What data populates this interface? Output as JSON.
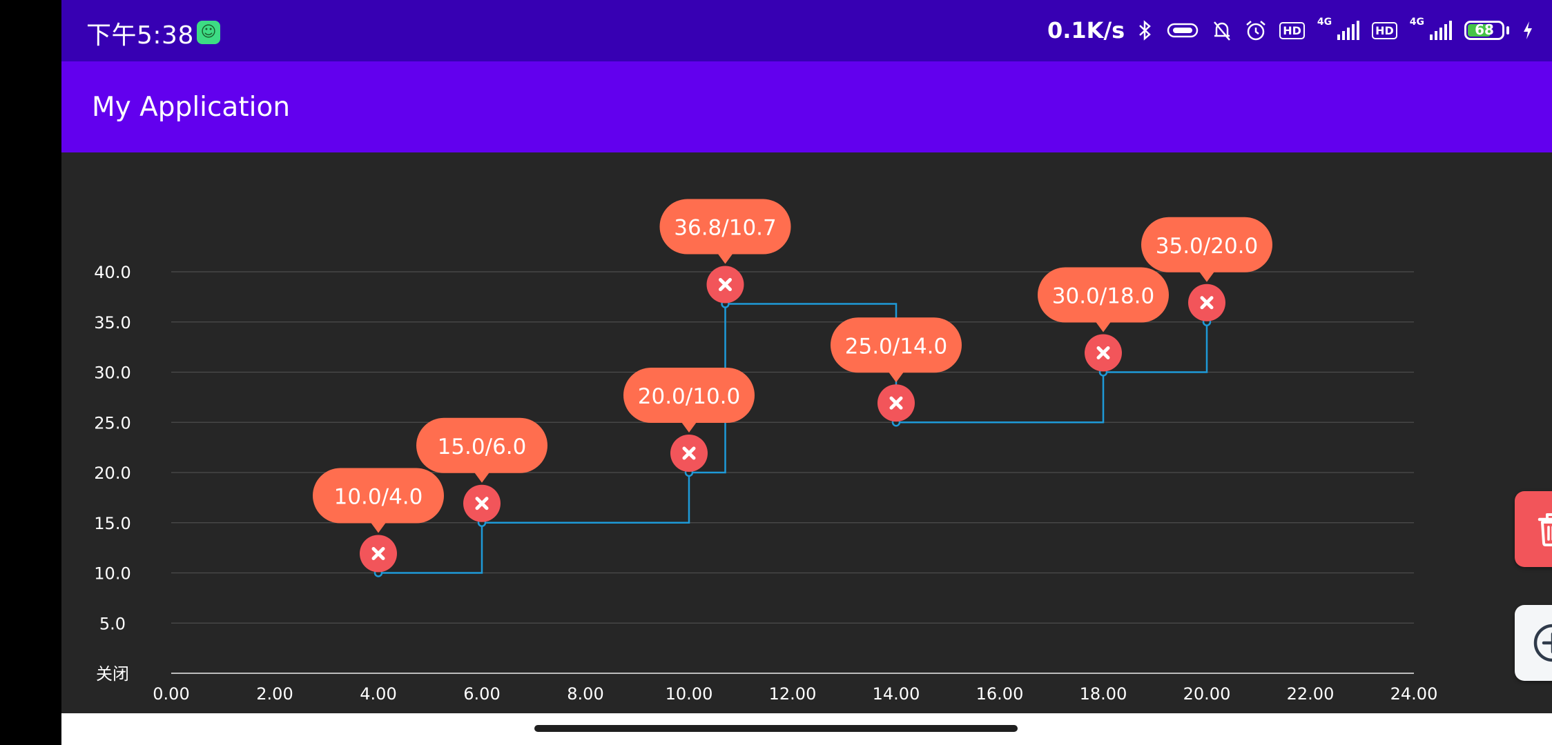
{
  "status_bar": {
    "time": "下午5:38",
    "network_speed": "0.1K/s",
    "net_type": "4G",
    "hd_label": "HD",
    "battery_level": "68",
    "icons": [
      "android-app-icon",
      "bluetooth-icon",
      "vibrate-icon",
      "mute-bell-icon",
      "alarm-icon",
      "hd-icon",
      "signal-icon",
      "battery-icon",
      "charging-icon"
    ]
  },
  "app_bar": {
    "title": "My Application"
  },
  "fabs": {
    "delete": {
      "icon": "trash-icon",
      "color": "#F2555A"
    },
    "add": {
      "icon": "add-circle-icon",
      "color": "#F4F6F8"
    }
  },
  "colors": {
    "status_bar": "#3700B3",
    "app_bar": "#6200EE",
    "chart_bg": "#262626",
    "line": "#1E9AD8",
    "bubble": "#FF6E4F",
    "marker": "#F2555A"
  },
  "chart_data": {
    "type": "line",
    "line_style": "stepped",
    "x": [
      4.0,
      6.0,
      10.0,
      10.7,
      14.0,
      18.0,
      20.0
    ],
    "y": [
      10.0,
      15.0,
      20.0,
      36.8,
      25.0,
      30.0,
      35.0
    ],
    "point_labels": [
      "10.0/4.0",
      "15.0/6.0",
      "20.0/10.0",
      "36.8/10.7",
      "25.0/14.0",
      "30.0/18.0",
      "35.0/20.0"
    ],
    "xlim": [
      0,
      24
    ],
    "ylim": [
      0,
      40
    ],
    "x_ticks": [
      "0.00",
      "2.00",
      "4.00",
      "6.00",
      "8.00",
      "10.00",
      "12.00",
      "14.00",
      "16.00",
      "18.00",
      "20.00",
      "22.00",
      "24.00"
    ],
    "y_tick_values": [
      0,
      5,
      10,
      15,
      20,
      25,
      30,
      35,
      40
    ],
    "y_ticks": [
      "关闭",
      "5.0",
      "10.0",
      "15.0",
      "20.0",
      "25.0",
      "30.0",
      "35.0",
      "40.0"
    ],
    "grid": true,
    "legend": "none"
  }
}
